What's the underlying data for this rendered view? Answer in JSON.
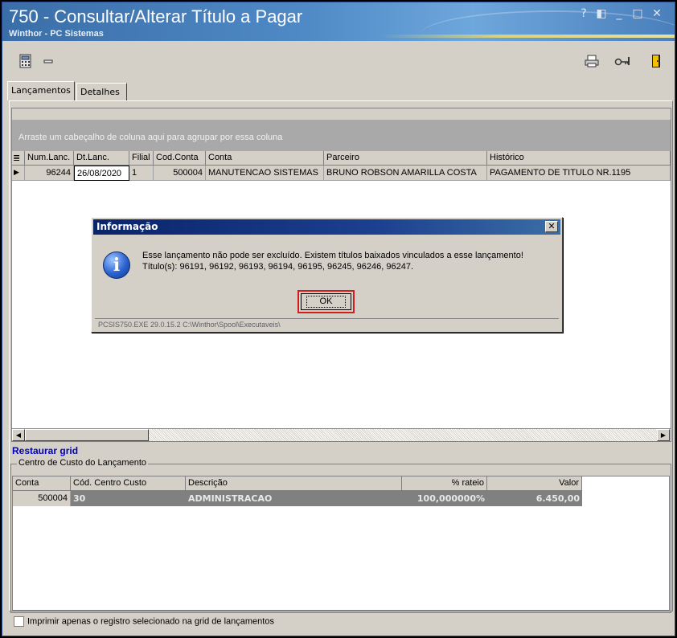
{
  "window": {
    "title": "750 - Consultar/Alterar Título a Pagar",
    "subtitle": "Winthor - PC Sistemas",
    "controls": [
      "?",
      "◧",
      "_",
      "□",
      "✕"
    ]
  },
  "toolbar": {
    "left_icons": [
      "calculator-icon",
      "minus-icon"
    ],
    "right_icons": [
      "printer-icon",
      "key-icon",
      "exit-door-icon"
    ]
  },
  "tabs": [
    {
      "label": "Lançamentos",
      "active": true
    },
    {
      "label": "Detalhes",
      "active": false
    }
  ],
  "grid": {
    "group_hint": "Arraste um cabeçalho de coluna aqui para agrupar por essa coluna",
    "columns": [
      "Num.Lanc.",
      "Dt.Lanc.",
      "Filial",
      "Cod.Conta",
      "Conta",
      "Parceiro",
      "Histórico"
    ],
    "rows": [
      [
        "96244",
        "26/08/2020",
        "1",
        "500004",
        "MANUTENCAO SISTEMAS",
        "BRUNO ROBSON AMARILLA COSTA",
        "PAGAMENTO DE TITULO NR.1195"
      ]
    ]
  },
  "restore_grid_label": "Restaurar grid",
  "cost_center": {
    "title": "Centro de Custo do Lançamento",
    "columns": [
      "Conta",
      "Cód. Centro Custo",
      "Descrição",
      "% rateio",
      "Valor"
    ],
    "rows": [
      [
        "500004",
        "30",
        "ADMINISTRACAO",
        "100,000000%",
        "6.450,00"
      ]
    ]
  },
  "print_selected_label": "Imprimir apenas o registro selecionado na grid de lançamentos",
  "dialog": {
    "title": "Informação",
    "message_line1": "Esse lançamento não pode ser excluído. Existem títulos baixados vinculados a esse lançamento!",
    "message_line2": "Título(s): 96191, 96192, 96193, 96194, 96195, 96245, 96246, 96247.",
    "ok_label": "OK",
    "status": "PCSIS750.EXE 29.0.15.2 C:\\Winthor\\Spool\\Executaveis\\",
    "highlight_color": "#d41c1c"
  }
}
